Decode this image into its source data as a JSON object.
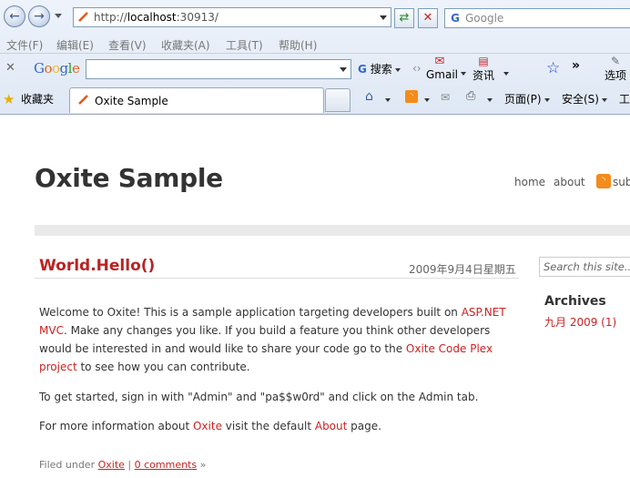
{
  "browser": {
    "url_prefix": "http://",
    "url_host": "localhost",
    "url_rest": ":30913/",
    "search_placeholder": "Google",
    "menus": [
      "文件(F)",
      "编辑(E)",
      "查看(V)",
      "收藏夹(A)",
      "工具(T)",
      "帮助(H)"
    ],
    "google_toolbar": {
      "logo": "Google",
      "search_label": "搜索",
      "gmail_label": "Gmail",
      "news_label": "资讯",
      "more_label": "»",
      "options_label": "选项"
    },
    "favorites_label": "收藏夹",
    "tab_title": "Oxite Sample",
    "commands": {
      "page": "页面(P)",
      "safety": "安全(S)",
      "tools": "工"
    }
  },
  "site": {
    "title": "Oxite Sample",
    "nav": {
      "home": "home",
      "about": "about",
      "subscribe": "sub"
    },
    "search_placeholder": "Search this site..."
  },
  "post": {
    "title": "World.Hello()",
    "date": "2009年9月4日星期五",
    "p1": {
      "a": "Welcome to Oxite! This is a sample application targeting developers built on ",
      "link1": "ASP.NET MVC",
      "b": ". Make any changes you like. If you build a feature you think other developers would be interested in and would like to share your code go to the ",
      "link2": "Oxite Code Plex project",
      "c": " to see how you can contribute."
    },
    "p2": "To get started, sign in with \"Admin\" and \"pa$$w0rd\" and click on the Admin tab.",
    "p3": {
      "a": "For more information about ",
      "link1": "Oxite",
      "b": " visit the default ",
      "link2": "About",
      "c": " page."
    },
    "filed": {
      "prefix": "Filed under ",
      "tag": "Oxite",
      "sep": " | ",
      "comments": "0 comments",
      "suffix": " »"
    }
  },
  "sidebar": {
    "archives_title": "Archives",
    "archive_item": "九月 2009 (1)"
  }
}
